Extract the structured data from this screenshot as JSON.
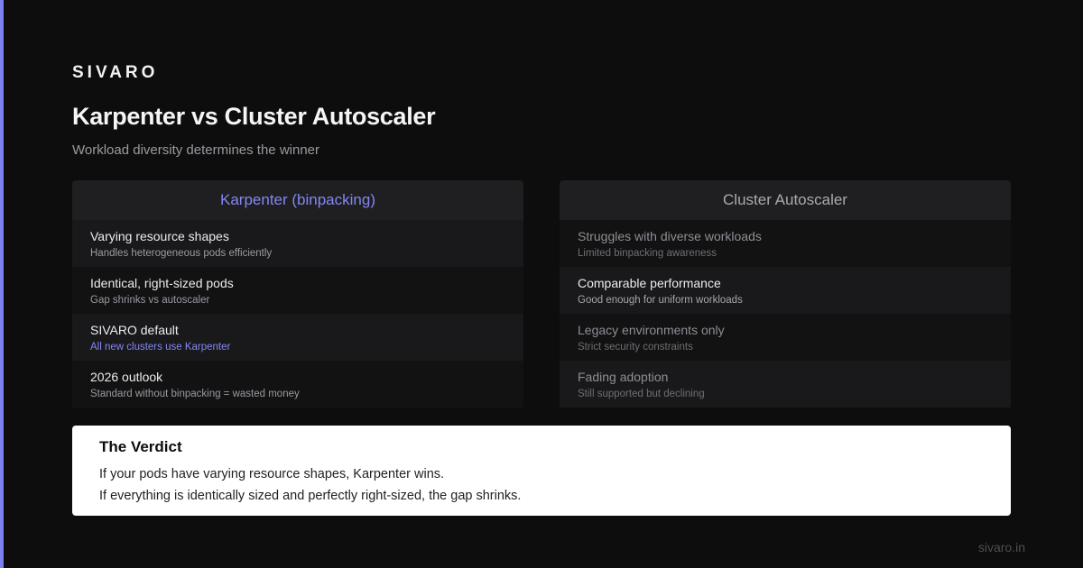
{
  "brand": "SIVARO",
  "title": "Karpenter vs Cluster Autoscaler",
  "subtitle": "Workload diversity determines the winner",
  "colors": {
    "background": "#0d0d0d",
    "accent": "#7b7ff0",
    "panel_header": "#1f1f22",
    "verdict_bg": "#ffffff"
  },
  "left": {
    "header": "Karpenter (binpacking)",
    "rows": [
      {
        "title": "Varying resource shapes",
        "desc": "Handles heterogeneous pods efficiently"
      },
      {
        "title": "Identical, right-sized pods",
        "desc": "Gap shrinks vs autoscaler"
      },
      {
        "title": "SIVARO default",
        "desc": "All new clusters use Karpenter"
      },
      {
        "title": "2026 outlook",
        "desc": "Standard without binpacking = wasted money"
      }
    ]
  },
  "right": {
    "header": "Cluster Autoscaler",
    "rows": [
      {
        "title": "Struggles with diverse workloads",
        "desc": "Limited binpacking awareness"
      },
      {
        "title": "Comparable performance",
        "desc": "Good enough for uniform workloads"
      },
      {
        "title": "Legacy environments only",
        "desc": "Strict security constraints"
      },
      {
        "title": "Fading adoption",
        "desc": "Still supported but declining"
      }
    ]
  },
  "verdict": {
    "title": "The Verdict",
    "line1": "If your pods have varying resource shapes, Karpenter wins.",
    "line2": "If everything is identically sized and perfectly right-sized, the gap shrinks."
  },
  "footer": "sivaro.in"
}
